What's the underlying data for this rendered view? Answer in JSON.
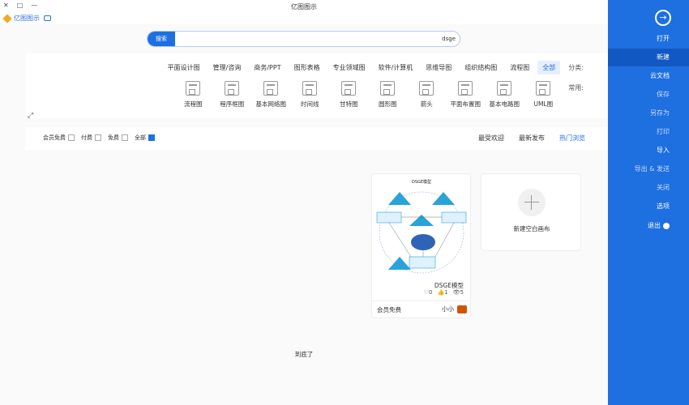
{
  "window": {
    "title": "亿图图示",
    "controls": [
      "—",
      "□",
      "✕"
    ]
  },
  "brand": {
    "name": "亿图图示"
  },
  "search": {
    "button": "搜索",
    "value": "dsge"
  },
  "categories": {
    "label": "分类:",
    "items": [
      "全部",
      "流程图",
      "组织结构图",
      "思维导图",
      "软件/计算机",
      "专业领域图",
      "图形表格",
      "商务/PPT",
      "管理/咨询",
      "平面设计图"
    ]
  },
  "common": {
    "label": "常用:",
    "items": [
      "UML图",
      "基本电路图",
      "平面布置图",
      "箭头",
      "圆形图",
      "甘特图",
      "时间线",
      "基本网络图",
      "程序框图",
      "流程图"
    ]
  },
  "tabs": [
    "热门浏览",
    "最新发布",
    "最受欢迎"
  ],
  "filters": [
    "全部",
    "免费",
    "付费",
    "会员免费"
  ],
  "new_card": {
    "text": "新建空白画布"
  },
  "template_card": {
    "diagram_title": "DSGE模型",
    "name": "DSGE模型",
    "views": "5",
    "likes": "1",
    "favorites": "0",
    "author": "小小",
    "price": "会员免费"
  },
  "bottom_note": "到底了",
  "sidebar": {
    "items": [
      {
        "label": "打开",
        "style": "normal"
      },
      {
        "label": "新建",
        "style": "active"
      },
      {
        "label": "云文档",
        "style": "normal"
      },
      {
        "label": "保存",
        "style": "dim"
      },
      {
        "label": "另存为",
        "style": "dim"
      },
      {
        "label": "打印",
        "style": "dim"
      },
      {
        "label": "导入",
        "style": "normal"
      },
      {
        "label": "导出 & 发送",
        "style": "dim"
      },
      {
        "label": "关闭",
        "style": "dim"
      },
      {
        "label": "选项",
        "style": "normal"
      },
      {
        "label": "退出",
        "style": "normal"
      }
    ]
  },
  "colors": {
    "accent": "#1e6fe0",
    "sidebar": "#1e6fe0",
    "diagram_blue": "#29a3d8"
  }
}
